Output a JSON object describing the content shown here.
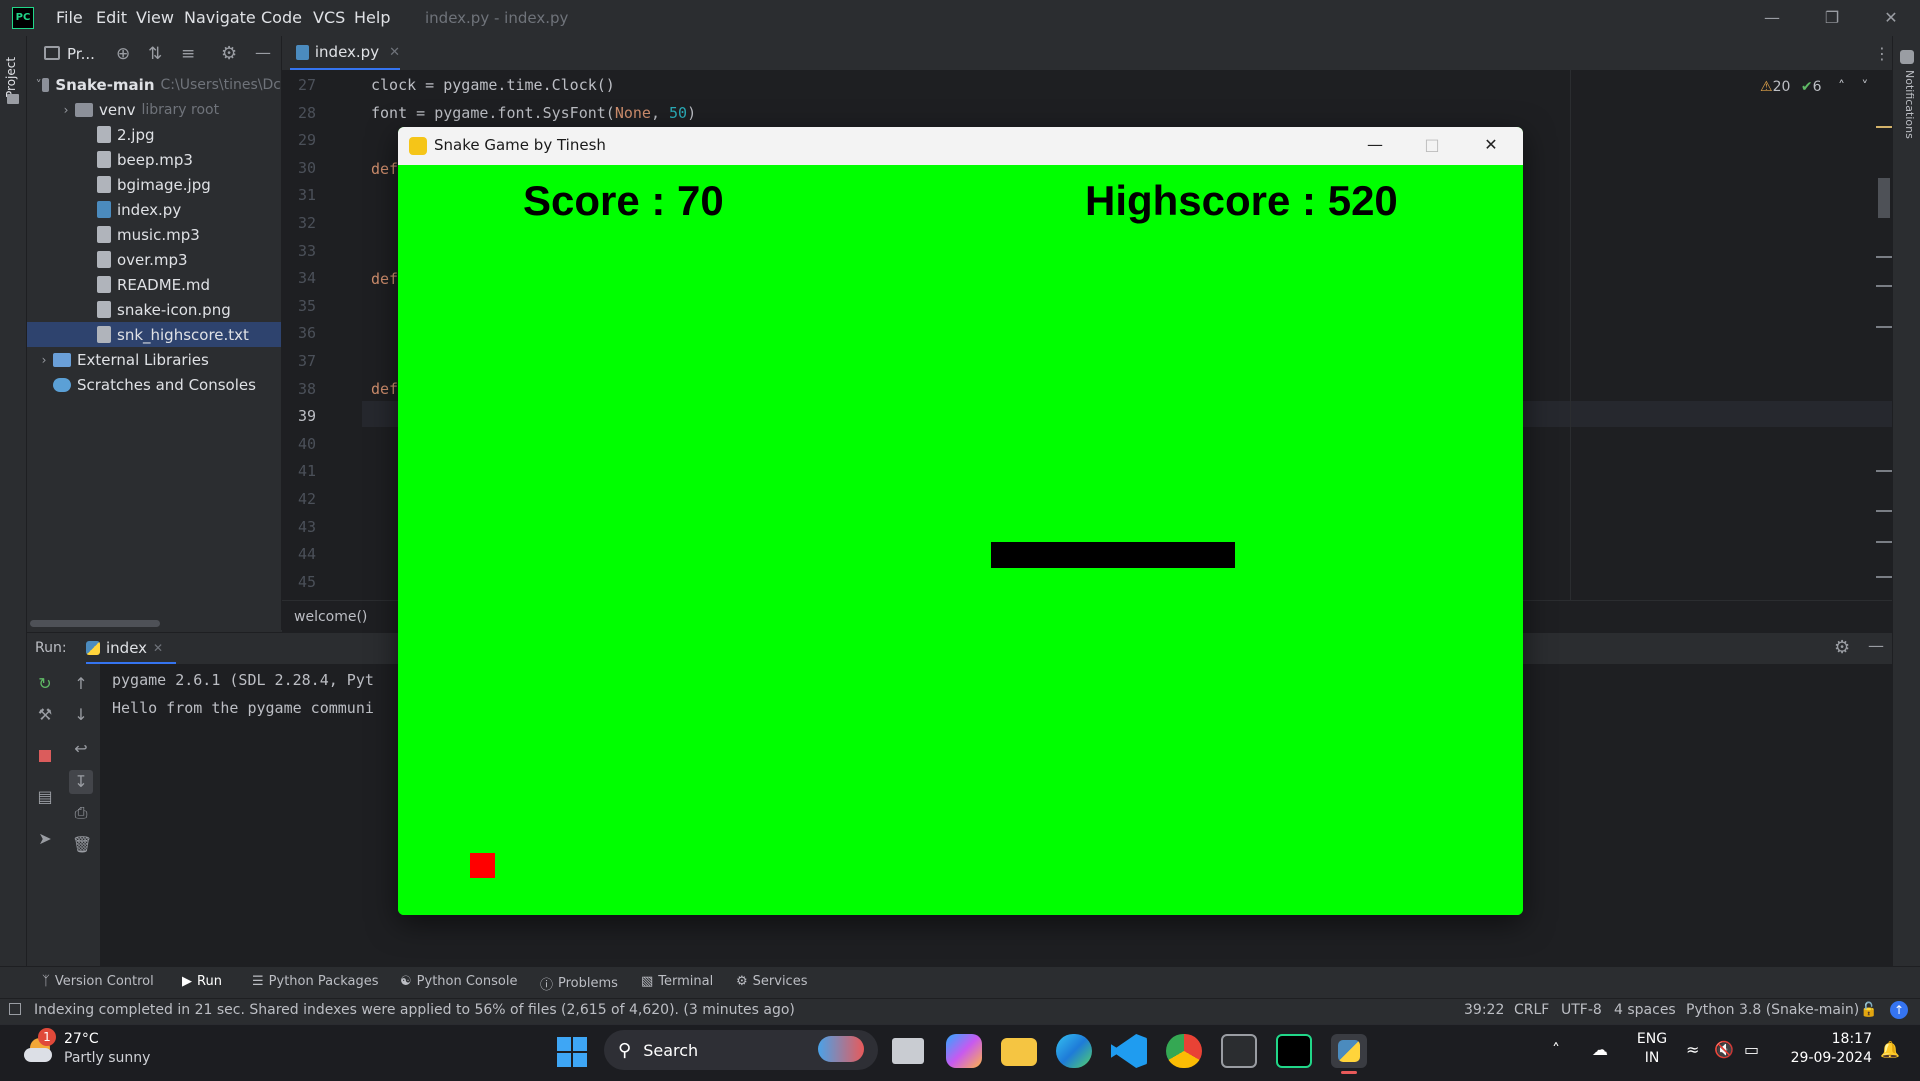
{
  "ide": {
    "logo_text": "PC",
    "menu": [
      "File",
      "Edit",
      "View",
      "Navigate",
      "Code",
      "VCS",
      "Help"
    ],
    "window_title": "index.py - index.py",
    "project_tab": "Pr...",
    "strip_label": "Project",
    "notifications_label": "Notifications",
    "editor_tab": "index.py",
    "inspection": {
      "warnings": "20",
      "ok": "6"
    },
    "breadcrumb": "welcome()"
  },
  "project_tree": [
    {
      "label": "Snake-main",
      "hint": "C:\\Users\\tines\\Dc",
      "type": "folder",
      "indent": 0,
      "expanded": true
    },
    {
      "label": "venv",
      "hint": "library root",
      "type": "folder",
      "indent": 1,
      "expanded": false
    },
    {
      "label": "2.jpg",
      "type": "file",
      "indent": 2
    },
    {
      "label": "beep.mp3",
      "type": "file",
      "indent": 2
    },
    {
      "label": "bgimage.jpg",
      "type": "file",
      "indent": 2
    },
    {
      "label": "index.py",
      "type": "py",
      "indent": 2
    },
    {
      "label": "music.mp3",
      "type": "file",
      "indent": 2
    },
    {
      "label": "over.mp3",
      "type": "file",
      "indent": 2
    },
    {
      "label": "README.md",
      "type": "file",
      "indent": 2
    },
    {
      "label": "snake-icon.png",
      "type": "file",
      "indent": 2
    },
    {
      "label": "snk_highscore.txt",
      "type": "file",
      "indent": 2,
      "selected": true
    },
    {
      "label": "External Libraries",
      "type": "lib",
      "indent": 0,
      "expanded": false
    },
    {
      "label": "Scratches and Consoles",
      "type": "scratch",
      "indent": 0
    }
  ],
  "code": {
    "line_numbers": [
      "27",
      "28",
      "29",
      "30",
      "31",
      "32",
      "33",
      "34",
      "35",
      "36",
      "37",
      "38",
      "39",
      "40",
      "41",
      "42",
      "43",
      "44",
      "45"
    ],
    "current_line": "39",
    "line27": "clock = pygame.time.Clock()",
    "line28_a": "font = pygame.font.SysFont(",
    "line28_none": "None",
    "line28_sep": ", ",
    "line28_num": "50",
    "line28_end": ")",
    "def_kw": "def"
  },
  "run": {
    "label": "Run:",
    "tab": "index",
    "console": [
      "pygame 2.6.1 (SDL 2.28.4, Pyt",
      "Hello from the pygame communi"
    ]
  },
  "tool_windows": [
    "Version Control",
    "Run",
    "Python Packages",
    "Python Console",
    "Problems",
    "Terminal",
    "Services"
  ],
  "status": {
    "message": "Indexing completed in 21 sec. Shared indexes were applied to 56% of files (2,615 of 4,620). (3 minutes ago)",
    "position": "39:22",
    "line_sep": "CRLF",
    "encoding": "UTF-8",
    "indent": "4 spaces",
    "interpreter": "Python 3.8 (Snake-main)"
  },
  "game": {
    "window_title": "Snake Game by Tinesh",
    "score": "Score : 70",
    "highscore": "Highscore : 520",
    "colors": {
      "background": "#00ff00",
      "snake": "#000000",
      "food": "#ff0000"
    }
  },
  "taskbar": {
    "weather_temp": "27°C",
    "weather_desc": "Partly sunny",
    "weather_badge": "1",
    "search": "Search",
    "lang_top": "ENG",
    "lang_bottom": "IN",
    "time": "18:17",
    "date": "29-09-2024"
  }
}
